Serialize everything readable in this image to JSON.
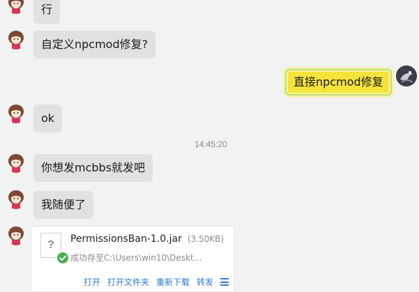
{
  "messages": [
    {
      "side": "left",
      "text": "行"
    },
    {
      "side": "left",
      "text": "自定义npcmod修复?"
    },
    {
      "side": "right",
      "text": "直接npcmod修复"
    },
    {
      "side": "left",
      "text": "ok"
    },
    {
      "side": "left",
      "text": "你想发mcbbs就发吧"
    },
    {
      "side": "left",
      "text": "我随便了"
    }
  ],
  "timestamp": "14:45:20",
  "file": {
    "name": "PermissionsBan-1.0.jar",
    "size": "(3.50KB)",
    "status": "成功存至C:\\Users\\win10\\Deskt...",
    "icon_glyph": "?",
    "actions": [
      "打开",
      "打开文件夹",
      "重新下载",
      "转发"
    ]
  },
  "colors": {
    "background": "#f2f2f2",
    "bubble_left": "#e1e1e1",
    "bubble_right": "#f5e33b",
    "link": "#2e7ad6",
    "success": "#4caf50"
  }
}
